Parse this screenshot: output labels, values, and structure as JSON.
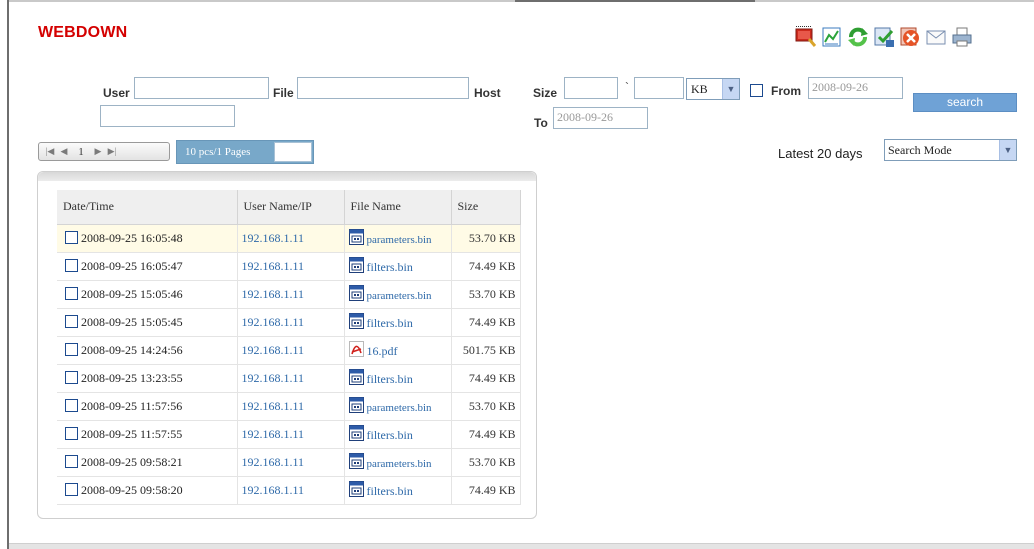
{
  "app": {
    "title": "WEBDOWN"
  },
  "toolbar": [
    {
      "name": "search-icon"
    },
    {
      "name": "chart-icon"
    },
    {
      "name": "refresh-icon"
    },
    {
      "name": "approve-icon"
    },
    {
      "name": "delete-icon"
    },
    {
      "name": "mail-icon"
    },
    {
      "name": "print-icon"
    }
  ],
  "filters": {
    "user_label": "User",
    "file_label": "File",
    "host_label": "Host",
    "size_label": "Size",
    "size_sep": "`",
    "unit": "KB",
    "from_label": "From",
    "from_value": "2008-09-26",
    "to_label": "To",
    "to_value": "2008-09-26",
    "search_label": "search"
  },
  "pager": {
    "current_page": "1",
    "summary": "10 pcs/1 Pages"
  },
  "range": {
    "latest_label": "Latest 20 days",
    "mode": "Search Mode"
  },
  "table": {
    "headers": [
      "Date/Time",
      "User Name/IP",
      "File Name",
      "Size"
    ],
    "rows": [
      {
        "date": "2008-09-25 16:05:48",
        "ip": "192.168.1.11",
        "file": "parameters.bin",
        "size": "53.70 KB",
        "type": "bin"
      },
      {
        "date": "2008-09-25 16:05:47",
        "ip": "192.168.1.11",
        "file": "filters.bin",
        "size": "74.49 KB",
        "type": "bin"
      },
      {
        "date": "2008-09-25 15:05:46",
        "ip": "192.168.1.11",
        "file": "parameters.bin",
        "size": "53.70 KB",
        "type": "bin"
      },
      {
        "date": "2008-09-25 15:05:45",
        "ip": "192.168.1.11",
        "file": "filters.bin",
        "size": "74.49 KB",
        "type": "bin"
      },
      {
        "date": "2008-09-25 14:24:56",
        "ip": "192.168.1.11",
        "file": "16.pdf",
        "size": "501.75 KB",
        "type": "pdf"
      },
      {
        "date": "2008-09-25 13:23:55",
        "ip": "192.168.1.11",
        "file": "filters.bin",
        "size": "74.49 KB",
        "type": "bin"
      },
      {
        "date": "2008-09-25 11:57:56",
        "ip": "192.168.1.11",
        "file": "parameters.bin",
        "size": "53.70 KB",
        "type": "bin"
      },
      {
        "date": "2008-09-25 11:57:55",
        "ip": "192.168.1.11",
        "file": "filters.bin",
        "size": "74.49 KB",
        "type": "bin"
      },
      {
        "date": "2008-09-25 09:58:21",
        "ip": "192.168.1.11",
        "file": "parameters.bin",
        "size": "53.70 KB",
        "type": "bin"
      },
      {
        "date": "2008-09-25 09:58:20",
        "ip": "192.168.1.11",
        "file": "filters.bin",
        "size": "74.49 KB",
        "type": "bin"
      }
    ]
  },
  "colors": {
    "title": "#d40000",
    "link": "#2f6aa9",
    "search_button": "#6fa2d6",
    "pager_bar": "#78a8c9",
    "highlight_row": "#fffbe6"
  }
}
